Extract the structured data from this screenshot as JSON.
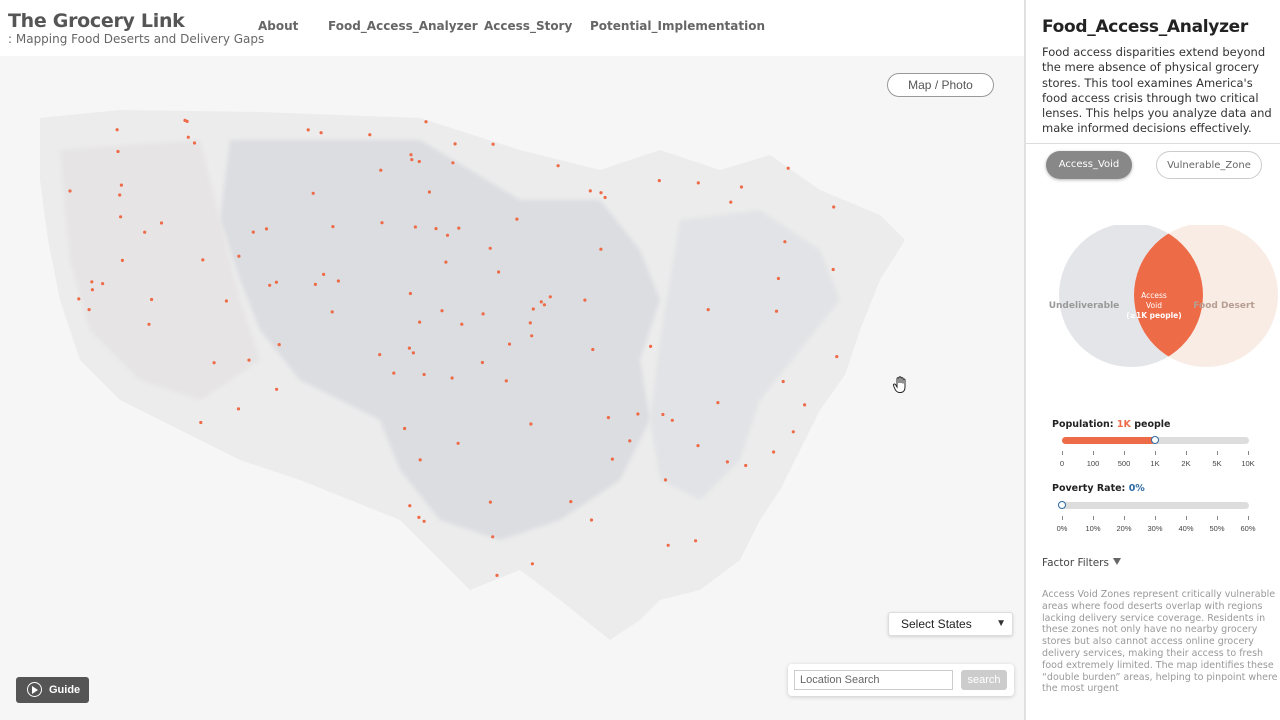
{
  "header": {
    "title": "The Grocery Link",
    "subtitle": ": Mapping Food Deserts and Delivery Gaps",
    "nav": [
      {
        "id": "about",
        "label": "About"
      },
      {
        "id": "analyzer",
        "label": "Food_Access_Analyzer"
      },
      {
        "id": "story",
        "label": "Access_Story"
      },
      {
        "id": "implementation",
        "label": "Potential_Implementation"
      }
    ]
  },
  "map": {
    "toggle_label": "Map / Photo",
    "states_select": "Select States",
    "search_placeholder": "Location Search",
    "search_button": "search",
    "guide_label": "Guide"
  },
  "panel": {
    "title": "Food_Access_Analyzer",
    "description": "Food access disparities extend beyond the mere absence of physical grocery stores. This tool examines America's food access crisis through two critical lenses. This helps you analyze data and make informed decisions effectively.",
    "tabs": [
      {
        "label": "Access_Void",
        "active": true
      },
      {
        "label": "Vulnerable_Zone",
        "active": false
      }
    ],
    "venn": {
      "left": "Undeliverable",
      "right": "Food Desert",
      "center_line1": "Access",
      "center_line2": "Void",
      "center_line3": "(≥1K people)"
    },
    "population": {
      "label": "Population:",
      "value": "1K",
      "unit": "people",
      "ticks": [
        "0",
        "100",
        "500",
        "1K",
        "2K",
        "5K",
        "10K"
      ],
      "selected_index": 3
    },
    "poverty": {
      "label": "Poverty Rate:",
      "value": "0%",
      "ticks": [
        "0%",
        "10%",
        "20%",
        "30%",
        "40%",
        "50%",
        "60%"
      ],
      "selected_index": 0
    },
    "factor_filters": "Factor Filters",
    "note": "Access Void Zones represent critically vulnerable areas where food deserts overlap with regions lacking delivery service coverage. Residents in these zones not only have no nearby grocery stores but also cannot access online grocery delivery services, making their access to fresh food extremely limited. The map identifies these “double burden” areas, helping to pinpoint where the most urgent"
  },
  "colors": {
    "accent": "#ee6b48",
    "tab_active": "#888888",
    "slider_thumb": "#2d6aa3"
  }
}
